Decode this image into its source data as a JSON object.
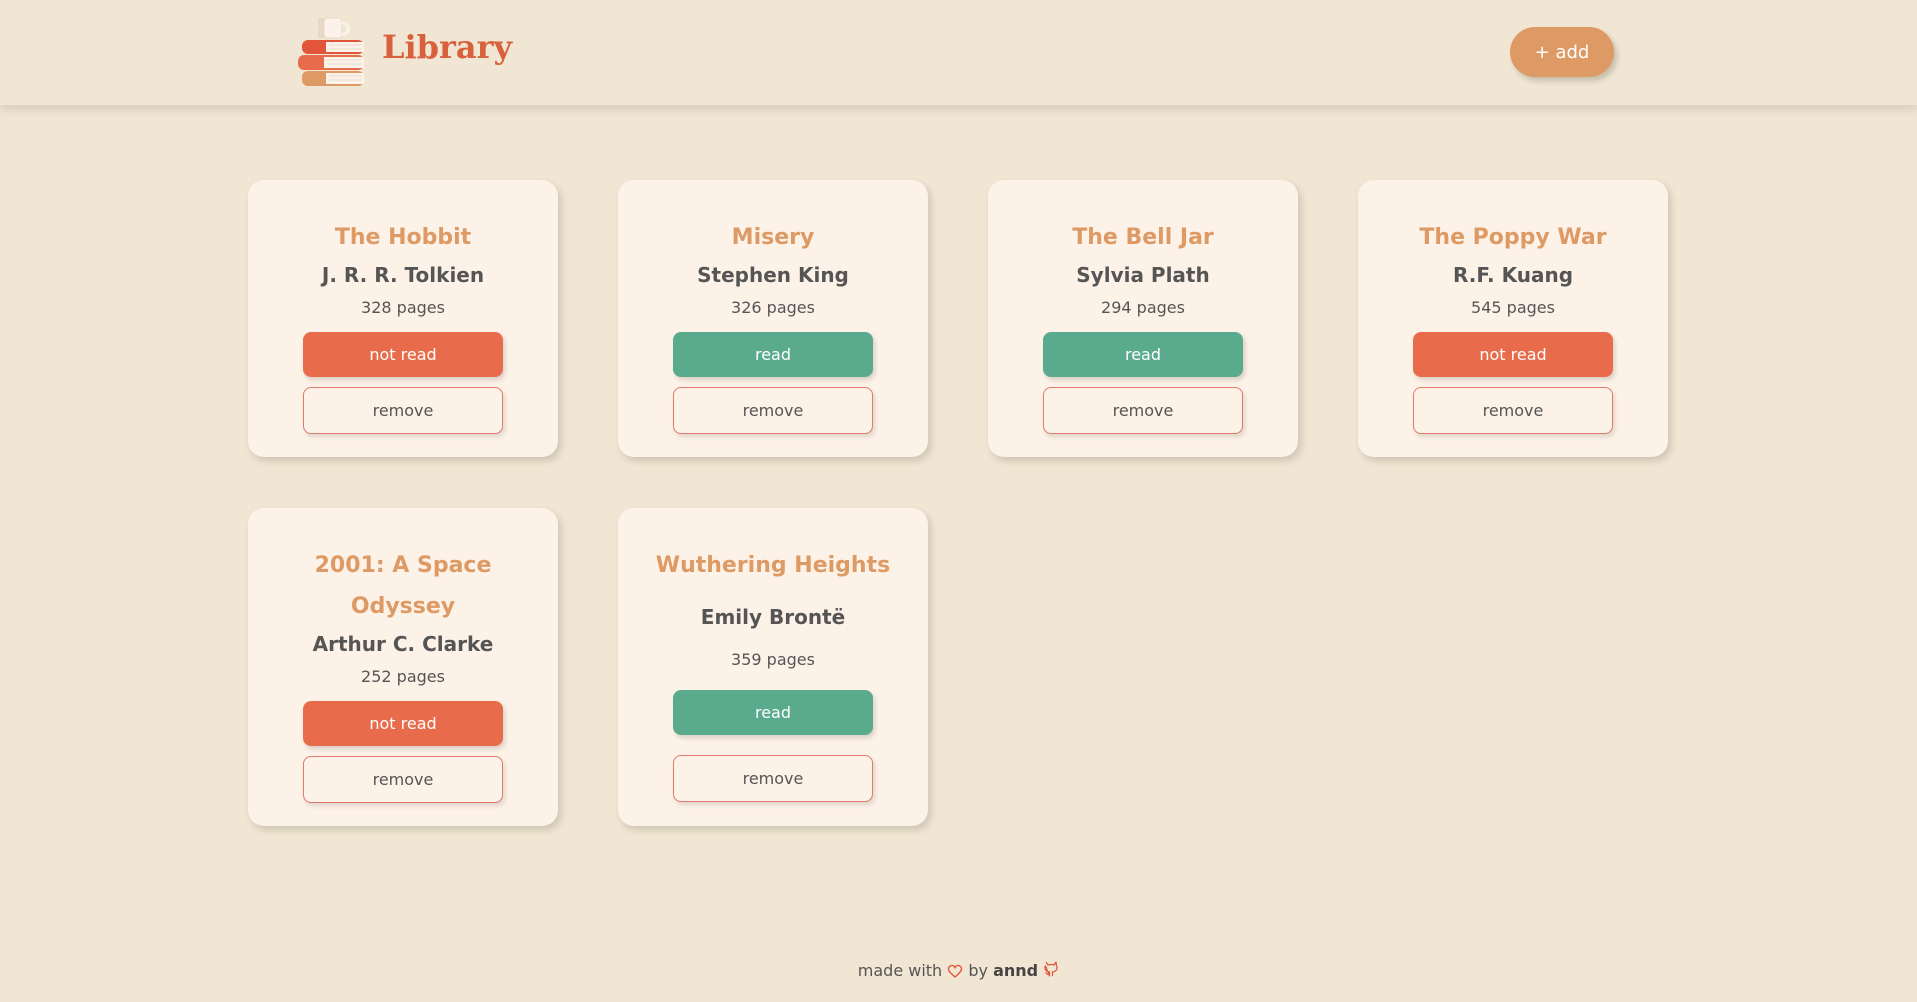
{
  "header": {
    "brand": "Library",
    "add_label": "+ add",
    "logo_icon": "books-with-cup-icon"
  },
  "books": [
    {
      "title": "The Hobbit",
      "author": "J. R. R. Tolkien",
      "pages": "328 pages",
      "status": "not read"
    },
    {
      "title": "Misery",
      "author": "Stephen King",
      "pages": "326 pages",
      "status": "read"
    },
    {
      "title": "The Bell Jar",
      "author": "Sylvia Plath",
      "pages": "294 pages",
      "status": "read"
    },
    {
      "title": "The Poppy War",
      "author": "R.F. Kuang",
      "pages": "545 pages",
      "status": "not read"
    },
    {
      "title": "2001: A Space Odyssey",
      "author": "Arthur C. Clarke",
      "pages": "252 pages",
      "status": "not read"
    },
    {
      "title": "Wuthering Heights",
      "author": "Emily Brontë",
      "pages": "359 pages",
      "status": "read"
    }
  ],
  "remove_label": "remove",
  "footer": {
    "prefix": "made with",
    "by": "by",
    "author": "annd",
    "heart_icon": "heart-icon",
    "github_icon": "github-icon"
  },
  "colors": {
    "background": "#f1e6d3",
    "card": "#fdf2e7",
    "brand": "#d9603c",
    "accent": "#dd9a65",
    "not_read": "#e86c4c",
    "read": "#5aab8d"
  }
}
